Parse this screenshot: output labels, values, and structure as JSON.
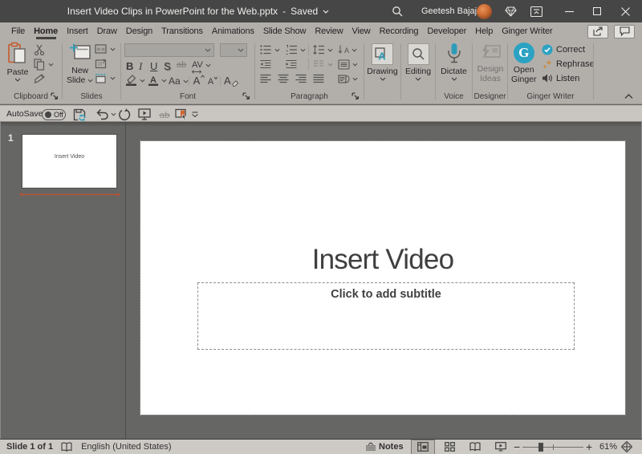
{
  "titlebar": {
    "title": "Insert Video Clips in PowerPoint for the Web.pptx",
    "dash": "-",
    "saved_label": "Saved",
    "user_name": "Geetesh Bajaj"
  },
  "tabs": {
    "items": [
      "File",
      "Home",
      "Insert",
      "Draw",
      "Design",
      "Transitions",
      "Animations",
      "Slide Show",
      "Review",
      "View",
      "Recording",
      "Developer",
      "Help",
      "Ginger Writer"
    ],
    "active": "Home"
  },
  "ribbon": {
    "paste": {
      "label": "Paste"
    },
    "clipboard_group": "Clipboard",
    "new_slide": {
      "line1": "New",
      "line2": "Slide"
    },
    "slides_group": "Slides",
    "font_group": "Font",
    "font_buttons": {
      "bold": "B",
      "italic": "I",
      "underline": "U",
      "shadow": "S",
      "strikethrough": "ab",
      "spacing": "AV",
      "case": "Aa",
      "grow": "A",
      "shrink": "A",
      "clear": "A"
    },
    "paragraph_group": "Paragraph",
    "drawing": {
      "label": "Drawing"
    },
    "editing": {
      "label": "Editing"
    },
    "dictate": {
      "label": "Dictate"
    },
    "voice_group": "Voice",
    "design_ideas": {
      "line1": "Design",
      "line2": "Ideas"
    },
    "designer_group": "Designer",
    "open_ginger": {
      "line1": "Open",
      "line2": "Ginger",
      "logo_letter": "G"
    },
    "ginger_buttons": {
      "correct": "Correct",
      "rephrase": "Rephrase",
      "listen": "Listen"
    },
    "ginger_group": "Ginger Writer"
  },
  "qat": {
    "autosave_label": "AutoSave",
    "autosave_state": "Off"
  },
  "slide_panel": {
    "slide_number": "1",
    "thumbnail_title": "Insert Video"
  },
  "slide": {
    "title": "Insert Video",
    "subtitle_placeholder": "Click to add subtitle"
  },
  "statusbar": {
    "slide_info": "Slide 1 of 1",
    "language": "English (United States)",
    "notes_label": "Notes",
    "zoom_level": "61%"
  },
  "colors": {
    "accent_teal": "#2D9CB8",
    "ginger_teal": "#2BA2C2",
    "paste_orange": "#C55A2B",
    "rephrase_gold": "#C98C42",
    "insert_line_red": "#C0502E"
  }
}
